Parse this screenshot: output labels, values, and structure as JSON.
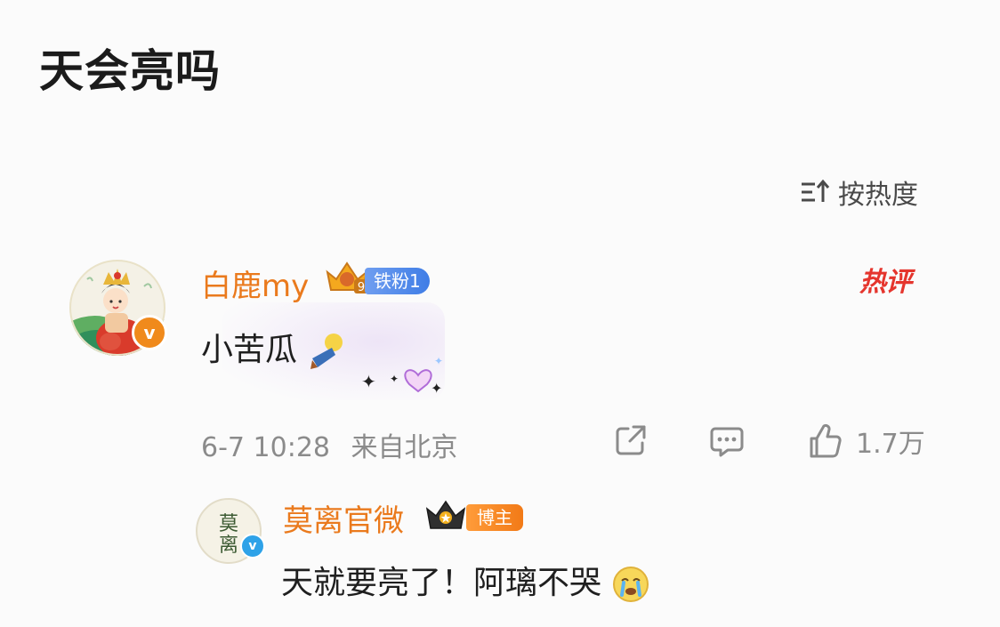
{
  "post": {
    "title": "天会亮吗"
  },
  "sort": {
    "label": "按热度",
    "icon": "sort-icon"
  },
  "comment": {
    "username": "白鹿my",
    "crown_level": "9",
    "fan_badge": "铁粉1",
    "hot_tag": "热评",
    "text": "小苦瓜",
    "timestamp": "6-7 10:28",
    "location": "来自北京",
    "like_count": "1.7万",
    "verify_badge": "v",
    "icons": {
      "share": "share-icon",
      "comment": "comment-icon",
      "like": "thumbs-up-icon"
    }
  },
  "reply": {
    "username": "莫离官微",
    "author_badge": "博主",
    "text": "天就要亮了！阿璃不哭",
    "verify_badge": "v",
    "avatar_text": "莫离"
  },
  "colors": {
    "username": "#ea7a1d",
    "hot": "#e5352d",
    "fan_badge": "#4f8ae9",
    "host_badge": "#f58a25",
    "meta": "#8b8b8b"
  }
}
